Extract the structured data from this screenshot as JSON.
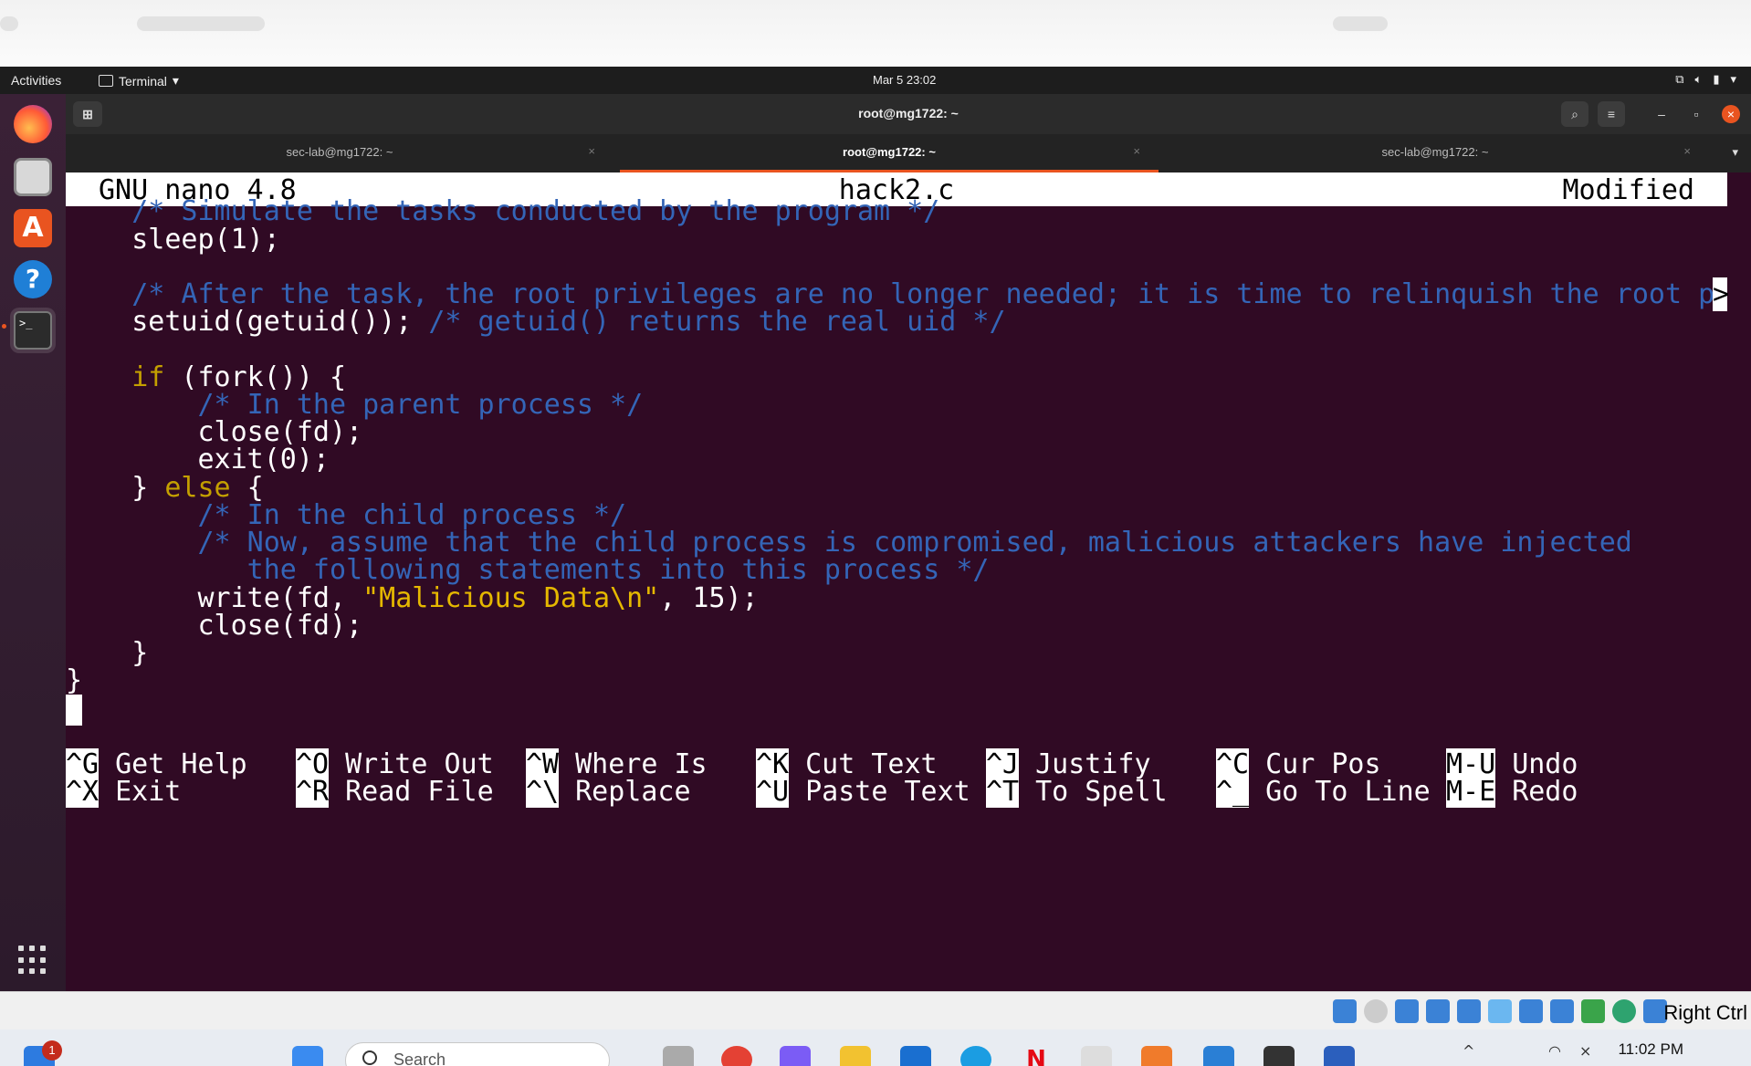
{
  "topbar": {
    "activities": "Activities",
    "app_menu": "Terminal",
    "clock": "Mar 5  23:02"
  },
  "terminal": {
    "window_title": "root@mg1722: ~",
    "tabs": [
      {
        "label": "sec-lab@mg1722: ~",
        "active": false
      },
      {
        "label": "root@mg1722: ~",
        "active": true
      },
      {
        "label": "sec-lab@mg1722: ~",
        "active": false
      }
    ]
  },
  "nano": {
    "version": "GNU nano 4.8",
    "filename": "hack2.c",
    "status": "Modified",
    "overflow_marker": ">",
    "lines": {
      "l1": "    /* Simulate the tasks conducted by the program */",
      "l2": "    sleep(1);",
      "l4": "    /* After the task, the root privileges are no longer needed; it is time to relinquish the root p",
      "l5a": "    setuid(getuid()); ",
      "l5b": "/* getuid() returns the real uid */",
      "l7a": "    ",
      "l7kw": "if",
      "l7b": " (fork()) {",
      "l8": "        /* In the parent process */",
      "l9": "        close(fd);",
      "l10": "        exit(0);",
      "l11a": "    } ",
      "l11kw": "else",
      "l11b": " {",
      "l12": "        /* In the child process */",
      "l13": "        /* Now, assume that the child process is compromised, malicious attackers have injected",
      "l14": "           the following statements into this process */",
      "l15a": "        write(fd, ",
      "l15str": "\"Malicious Data\\n\"",
      "l15b": ", 15);",
      "l16": "        close(fd);",
      "l17": "    }",
      "l18": "}"
    },
    "shortcuts": [
      {
        "key": "^G",
        "label": "Get Help"
      },
      {
        "key": "^X",
        "label": "Exit"
      },
      {
        "key": "^O",
        "label": "Write Out"
      },
      {
        "key": "^R",
        "label": "Read File"
      },
      {
        "key": "^W",
        "label": "Where Is"
      },
      {
        "key": "^\\",
        "label": "Replace"
      },
      {
        "key": "^K",
        "label": "Cut Text"
      },
      {
        "key": "^U",
        "label": "Paste Text"
      },
      {
        "key": "^J",
        "label": "Justify"
      },
      {
        "key": "^T",
        "label": "To Spell"
      },
      {
        "key": "^C",
        "label": "Cur Pos"
      },
      {
        "key": "^_",
        "label": "Go To Line"
      },
      {
        "key": "M-U",
        "label": "Undo"
      },
      {
        "key": "M-E",
        "label": "Redo"
      }
    ]
  },
  "vbox": {
    "host_key": "Right Ctrl"
  },
  "taskbar": {
    "search_placeholder": "Search",
    "time": "11:02 PM",
    "notification_count": "1"
  },
  "colors": {
    "terminal_bg": "#300a24",
    "comment": "#3465b7",
    "keyword": "#c4a000",
    "accent": "#e95420"
  }
}
